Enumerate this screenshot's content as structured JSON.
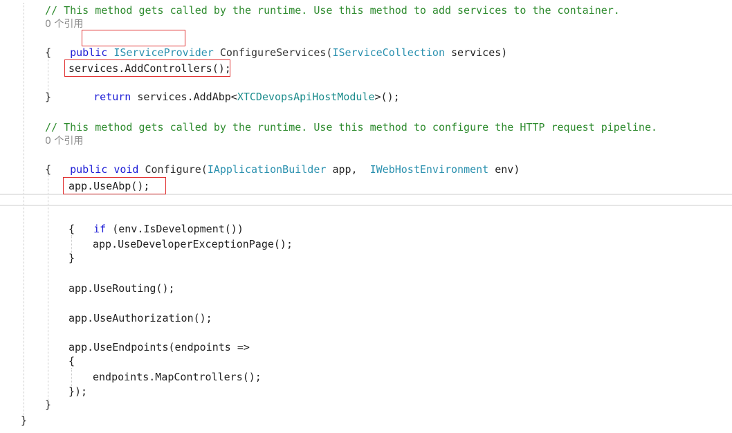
{
  "editor": {
    "lines": {
      "c1": "// This method gets called by the runtime. Use this method to add services to the container.",
      "ref1": "0 个引用",
      "l3_kw": "public",
      "l3_type": "IServiceProvider",
      "l3_meth": "ConfigureServices(",
      "l3_ptype": "IServiceCollection",
      "l3_rest": "services)",
      "brace_open1": "{",
      "l5": "services.AddControllers();",
      "l6_kw": "return",
      "l6_a": "services.AddAbp<",
      "l6_type": "XTCDevopsApiHostModule",
      "l6_b": ">();",
      "brace_close1": "}",
      "c2": "// This method gets called by the runtime. Use this method to configure the HTTP request pipeline.",
      "ref2": "0 个引用",
      "l10_kw": "public void",
      "l10_meth": "Configure(",
      "l10_t1": "IApplicationBuilder",
      "l10_p1": "app,",
      "l10_t2": "IWebHostEnvironment",
      "l10_p2": "env)",
      "brace_open2": "{",
      "l12": "app.UseAbp();",
      "l14_kw": "if",
      "l14_rest": "(env.IsDevelopment())",
      "brace_open3": "{",
      "l16": "app.UseDeveloperExceptionPage();",
      "brace_close3": "}",
      "l18": "app.UseRouting();",
      "l19": "app.UseAuthorization();",
      "l20": "app.UseEndpoints(endpoints =>",
      "brace_open4": "{",
      "l22": "endpoints.MapControllers();",
      "l23": "});",
      "brace_close2": "}",
      "brace_close0": "}"
    },
    "highlight_color": "#e03030"
  }
}
